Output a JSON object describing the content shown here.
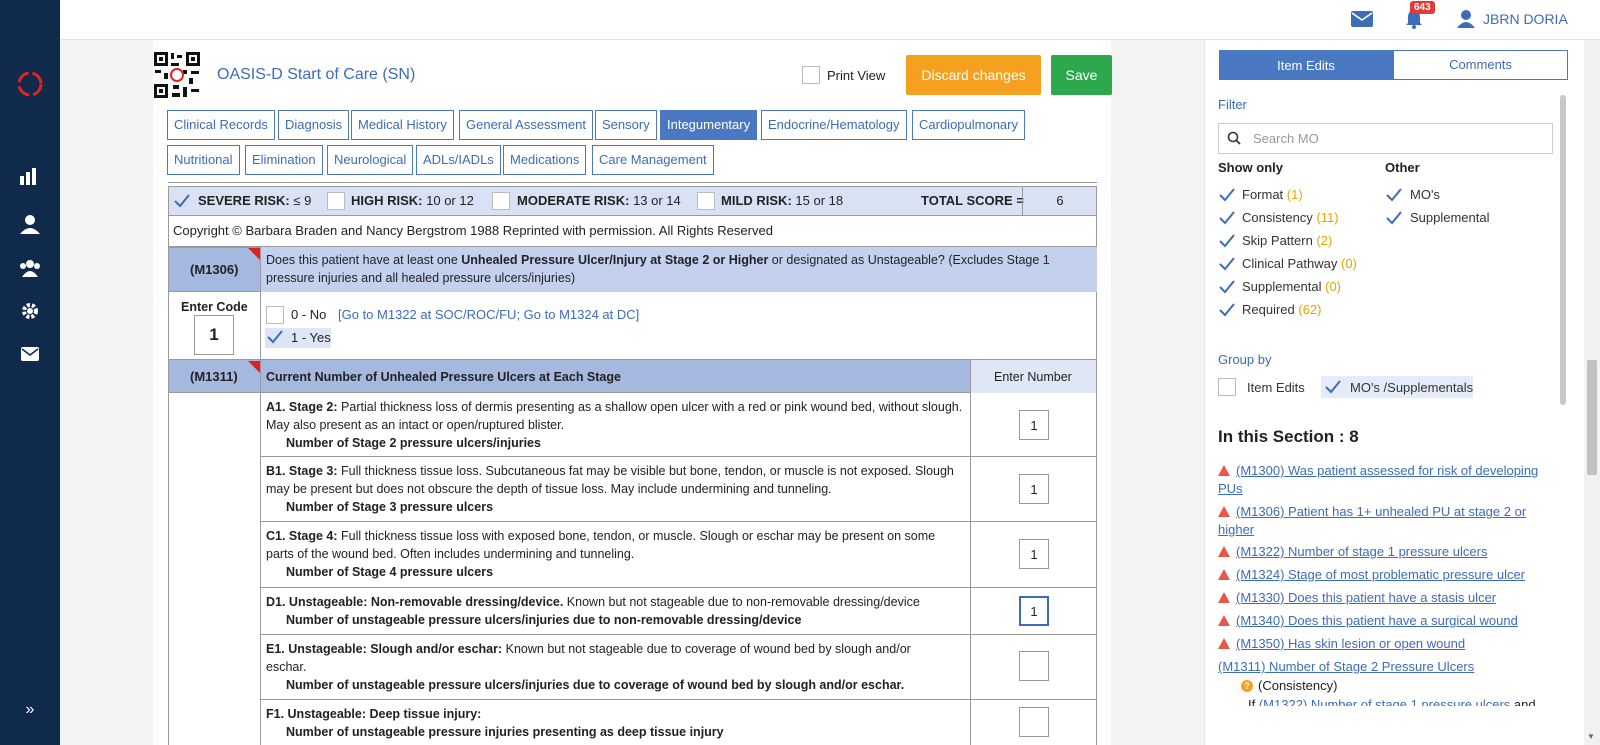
{
  "user": {
    "name": "JBRN DORIA",
    "notification_count": "643"
  },
  "form": {
    "title": "OASIS-D Start of Care (SN)",
    "print_view_label": "Print View",
    "discard_label": "Discard changes",
    "save_label": "Save"
  },
  "tabs_row1": [
    "Clinical Records",
    "Diagnosis",
    "Medical History",
    "General Assessment",
    "Sensory",
    "Integumentary",
    "Endocrine/Hematology",
    "Cardiopulmonary"
  ],
  "tabs_row2": [
    "Nutritional",
    "Elimination",
    "Neurological",
    "ADLs/IADLs",
    "Medications",
    "Care Management"
  ],
  "risk": {
    "severe_label": "SEVERE RISK:",
    "severe_range": "≤ 9",
    "high_label": "HIGH RISK:",
    "high_range": "10 or 12",
    "moderate_label": "MODERATE RISK:",
    "moderate_range": "13 or 14",
    "mild_label": "MILD RISK:",
    "mild_range": "15 or 18",
    "total_label": "TOTAL SCORE =",
    "total_value": "6"
  },
  "copyright": "Copyright © Barbara Braden and Nancy Bergstrom 1988 Reprinted with permission. All Rights Reserved",
  "m1306": {
    "code": "(M1306)",
    "q_pre": "Does this patient have at least one ",
    "q_bold": "Unhealed Pressure Ulcer/Injury at Stage 2 or Higher",
    "q_post": " or designated as Unstageable? (Excludes Stage 1 pressure injuries and all healed pressure ulcers/injuries)",
    "enter_code_label": "Enter Code",
    "value": "1",
    "opt0": "0 - No",
    "opt0_skip": "[Go to M1322 at SOC/ROC/FU; Go to M1324 at DC]",
    "opt1": "1 - Yes"
  },
  "m1311": {
    "code": "(M1311)",
    "title": "Current Number of Unhealed Pressure Ulcers at Each Stage",
    "enter_number_label": "Enter Number",
    "rows": [
      {
        "head": "A1. Stage 2:",
        "desc": " Partial thickness loss of dermis presenting as a shallow open ulcer with a red or pink wound bed, without slough. May also present as an intact or open/ruptured blister.",
        "sub": "Number of Stage 2 pressure ulcers/injuries",
        "value": "1"
      },
      {
        "head": "B1. Stage 3:",
        "desc": " Full thickness tissue loss. Subcutaneous fat may be visible but bone, tendon, or muscle is not exposed. Slough may be present but does not obscure the depth of tissue loss. May include undermining and tunneling.",
        "sub": "Number of Stage 3 pressure ulcers",
        "value": "1"
      },
      {
        "head": "C1. Stage 4:",
        "desc": " Full thickness tissue loss with exposed bone, tendon, or muscle. Slough or eschar may be present on some parts of the wound bed. Often includes undermining and tunneling.",
        "sub": "Number of Stage 4 pressure ulcers",
        "value": "1"
      },
      {
        "head": "D1. Unstageable: Non-removable dressing/device.",
        "desc": " Known but not stageable due to non-removable dressing/device",
        "sub": "Number of unstageable pressure ulcers/injuries due to non-removable dressing/device",
        "value": "1"
      },
      {
        "head": "E1. Unstageable: Slough and/or eschar:",
        "desc": " Known but not stageable due to coverage of wound bed by slough and/or eschar.",
        "sub": "Number of unstageable pressure ulcers/injuries due to coverage of wound bed by slough and/or eschar.",
        "value": ""
      },
      {
        "head": "F1. Unstageable: Deep tissue injury:",
        "desc": "",
        "sub": "Number of unstageable pressure injuries presenting as deep tissue injury",
        "value": ""
      }
    ]
  },
  "panel": {
    "tab_item_edits": "Item Edits",
    "tab_comments": "Comments",
    "filter_label": "Filter",
    "search_placeholder": "Search MO",
    "show_only_label": "Show only",
    "other_label": "Other",
    "show_only": [
      {
        "label": "Format",
        "count": "(1)"
      },
      {
        "label": "Consistency",
        "count": "(11)"
      },
      {
        "label": "Skip Pattern",
        "count": "(2)"
      },
      {
        "label": "Clinical Pathway",
        "count": "(0)"
      },
      {
        "label": "Supplemental",
        "count": "(0)"
      },
      {
        "label": "Required",
        "count": "(62)"
      }
    ],
    "other": [
      "MO's",
      "Supplemental"
    ],
    "group_by_label": "Group by",
    "group_item_edits": "Item Edits",
    "group_mos": "MO's /Supplementals",
    "section_title": "In this Section : 8",
    "section_items": [
      "(M1300) Was patient assessed for risk of developing PUs",
      "(M1306) Patient has 1+ unhealed PU at stage 2 or higher",
      "(M1322) Number of stage 1 pressure ulcers",
      "(M1324) Stage of most problematic pressure ulcer",
      "(M1330) Does this patient have a stasis ulcer",
      "(M1340) Does this patient have a surgical wound",
      "(M1350) Has skin lesion or open wound"
    ],
    "m1311_link": "(M1311) Number of Stage 2 Pressure Ulcers",
    "consistency_label": "(Consistency)",
    "partial_prefix": "If ",
    "partial_link": "(M1322) Number of stage 1 pressure ulcers",
    "partial_suffix": " and"
  },
  "colors": {
    "sidebar": "#0f2a4a",
    "accent": "#4a78c2",
    "discard": "#f5a01f",
    "save": "#2ea84f",
    "warning": "#e8584a"
  }
}
